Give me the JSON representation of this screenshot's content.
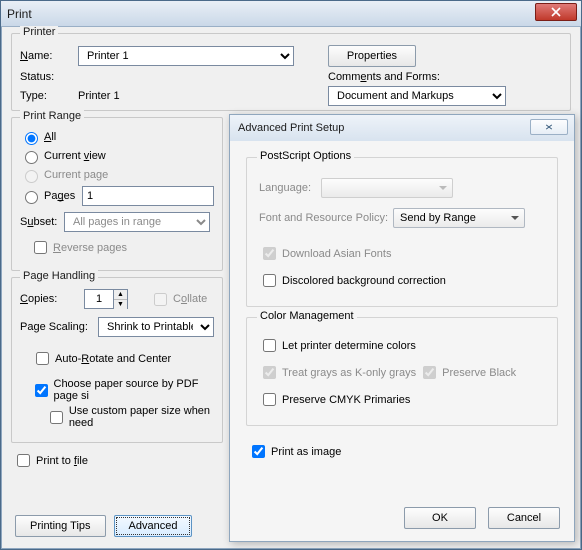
{
  "win": {
    "title": "Print",
    "printer_group": "Printer",
    "name_label": "Name:",
    "name_value": "Printer 1",
    "properties_btn": "Properties",
    "status_label": "Status:",
    "type_label": "Type:",
    "type_value": "Printer 1",
    "comments_label": "Comments and Forms:",
    "comments_value": "Document and Markups"
  },
  "range": {
    "legend": "Print Range",
    "all": "All",
    "current_view": "Current view",
    "current_page": "Current page",
    "pages": "Pages",
    "pages_value": "1",
    "subset_label": "Subset:",
    "subset_value": "All pages in range",
    "reverse": "Reverse pages"
  },
  "ph": {
    "legend": "Page Handling",
    "copies_label": "Copies:",
    "copies_value": "1",
    "collate": "Collate",
    "scaling_label": "Page Scaling:",
    "scaling_value": "Shrink to Printable Area",
    "autorotate": "Auto-Rotate and Center",
    "choose_paper": "Choose paper source by PDF page size",
    "use_custom": "Use custom paper size when needed"
  },
  "footer": {
    "print_to_file": "Print to file",
    "tips": "Printing Tips",
    "advanced": "Advanced"
  },
  "adv": {
    "title": "Advanced Print Setup",
    "ps_legend": "PostScript Options",
    "lang_label": "Language:",
    "frp_label": "Font and Resource Policy:",
    "frp_value": "Send by Range",
    "dl_asian": "Download Asian Fonts",
    "discolored": "Discolored background correction",
    "cm_legend": "Color Management",
    "let_printer": "Let printer determine colors",
    "treat_grays": "Treat grays as K-only grays",
    "preserve_black": "Preserve Black",
    "preserve_cmyk": "Preserve CMYK Primaries",
    "print_as_image": "Print as image",
    "ok": "OK",
    "cancel": "Cancel"
  }
}
